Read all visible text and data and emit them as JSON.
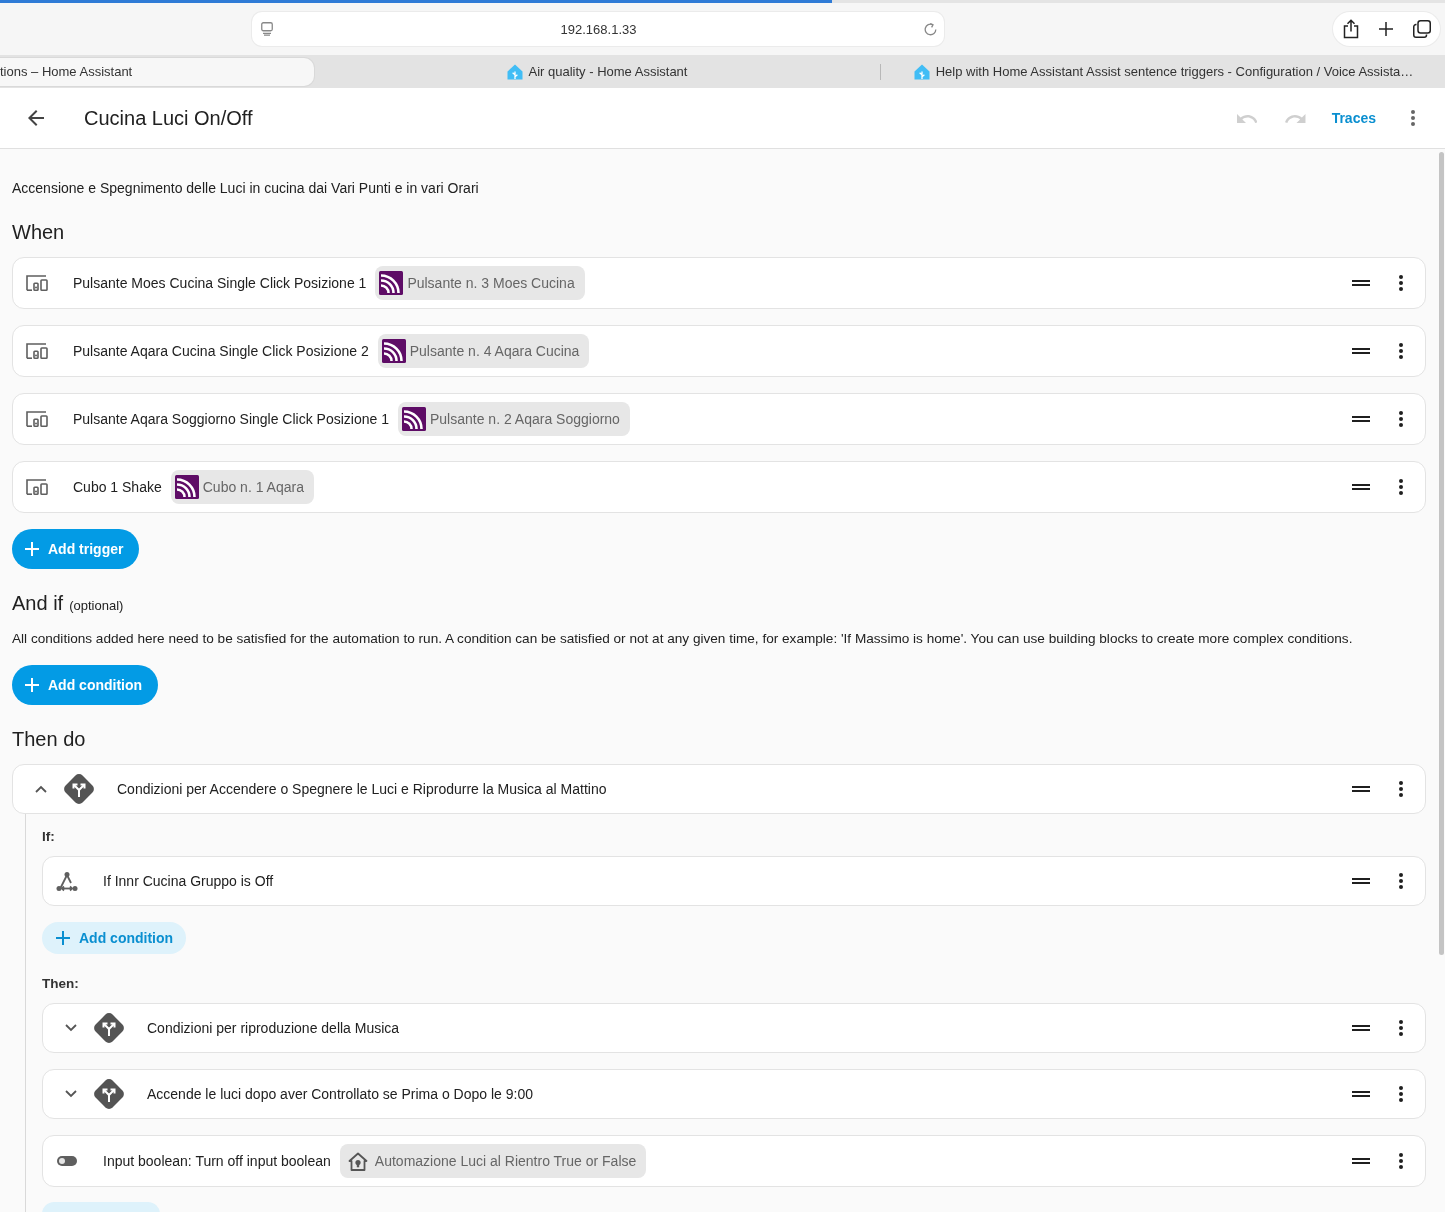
{
  "browser": {
    "progress": {
      "level": 0.576
    },
    "url": "192.168.1.33",
    "tabs": [
      {
        "title": "tions – Home Assistant",
        "favicon": false,
        "selected": true
      },
      {
        "title": "Air quality - Home Assistant",
        "favicon": true,
        "selected": false
      },
      {
        "title": "Help with Home Assistant Assist sentence triggers - Configuration / Voice Assista…",
        "favicon": true,
        "selected": false
      }
    ]
  },
  "header": {
    "title": "Cucina Luci On/Off",
    "undo": {
      "disabled": true
    },
    "redo": {
      "disabled": true
    },
    "traces": "Traces"
  },
  "description": "Accensione e Spegnimento delle Luci in cucina dai Vari Punti e in vari Orari",
  "triggers": {
    "heading": "When",
    "items": [
      {
        "kind": "device",
        "label": "Pulsante Moes Cucina Single Click Posizione 1",
        "chip": {
          "kind": "device",
          "label": "Pulsante n. 3 Moes Cucina"
        }
      },
      {
        "kind": "device",
        "label": "Pulsante Aqara Cucina Single Click Posizione 2",
        "chip": {
          "kind": "device",
          "label": "Pulsante n. 4 Aqara Cucina"
        }
      },
      {
        "kind": "device",
        "label": "Pulsante Aqara Soggiorno Single Click Posizione 1",
        "chip": {
          "kind": "device",
          "label": "Pulsante n. 2 Aqara Soggiorno"
        }
      },
      {
        "kind": "device",
        "label": "Cubo 1 Shake",
        "chip": {
          "kind": "device",
          "label": "Cubo n. 1 Aqara"
        }
      }
    ],
    "add_button": "Add trigger"
  },
  "conditions": {
    "heading": "And if",
    "hint": "(optional)",
    "help": "All conditions added here need to be satisfied for the automation to run. A condition can be satisfied or not at any given time, for example: 'If Massimo is home'. You can use building blocks to create more complex conditions.",
    "add_button": "Add condition"
  },
  "actions": {
    "heading": "Then do",
    "items": [
      {
        "kind": "choose",
        "label": "Condizioni per Accendere o Spegnere le Luci e Riprodurre la Musica al Mattino",
        "expanded": true,
        "if_label": "If:",
        "conditions": [
          {
            "kind": "state",
            "label": "If Innr Cucina Gruppo is Off"
          }
        ],
        "add_condition": "Add condition",
        "then_label": "Then:",
        "then": [
          {
            "kind": "choose",
            "label": "Condizioni per riproduzione della Musica",
            "expanded": false
          },
          {
            "kind": "choose",
            "label": "Accende le luci dopo aver Controllato se Prima o Dopo le 9:00",
            "expanded": false
          },
          {
            "kind": "input_boolean",
            "label": "Input boolean: Turn off input boolean",
            "chip": {
              "kind": "entity",
              "label": "Automazione Luci al Rientro True or False"
            }
          }
        ]
      }
    ]
  }
}
